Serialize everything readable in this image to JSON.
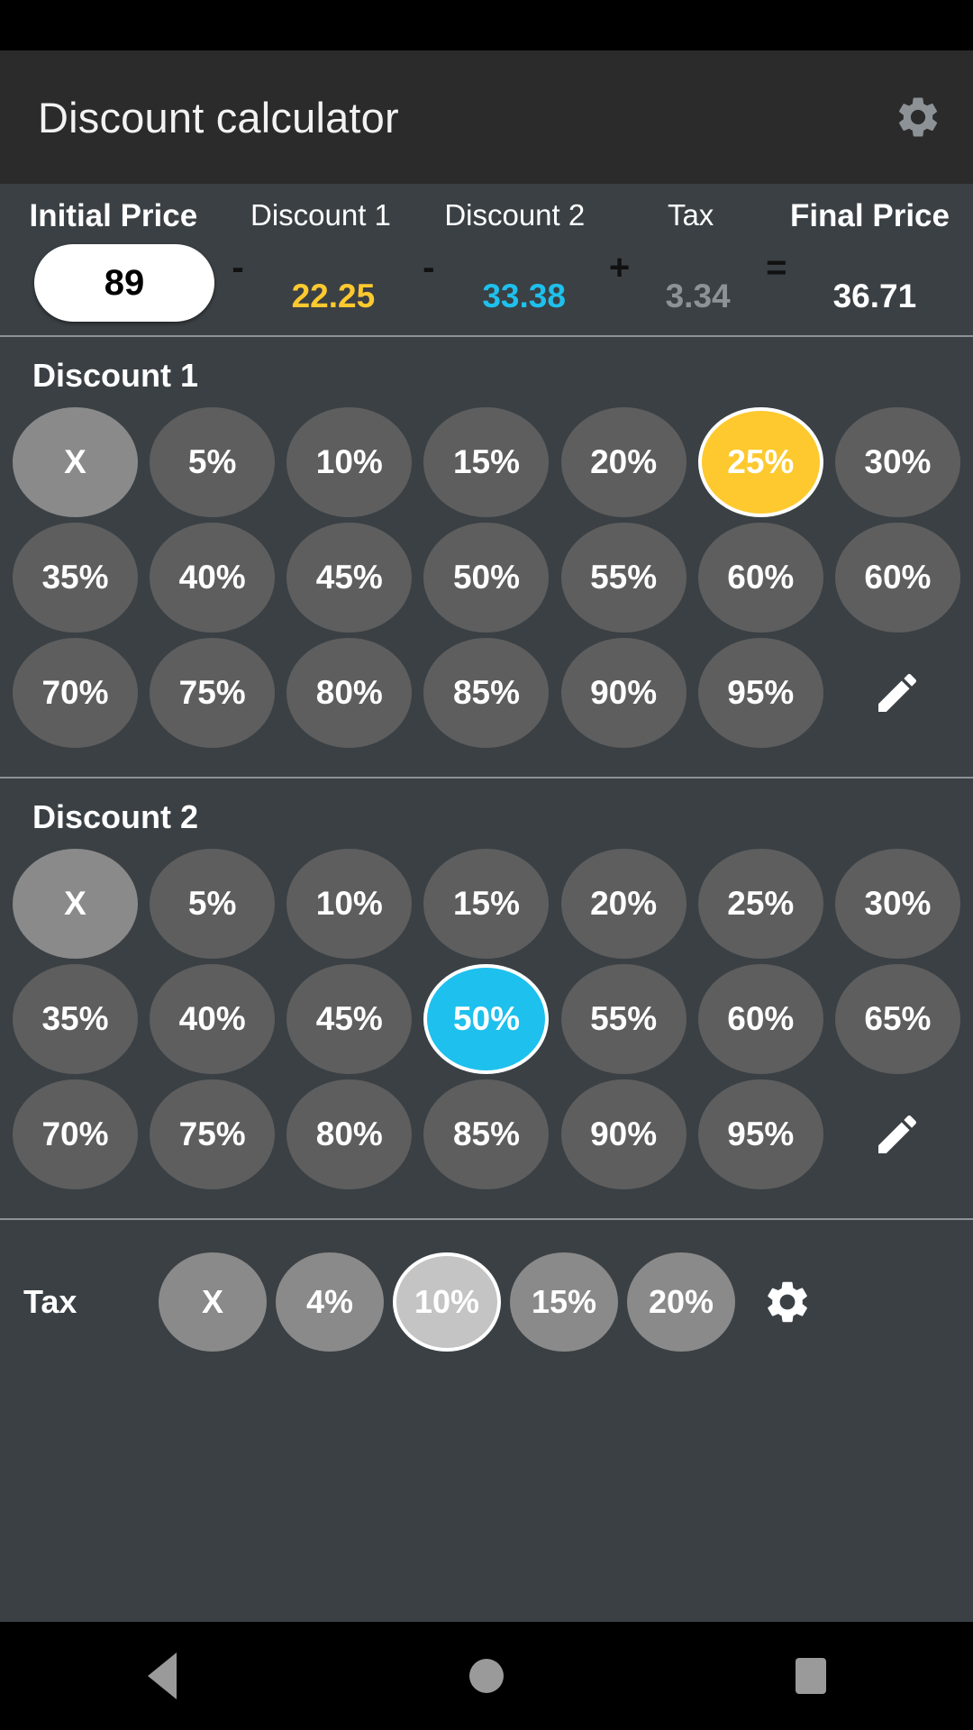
{
  "app": {
    "title": "Discount calculator",
    "settings_icon": "gear-icon"
  },
  "summary": {
    "initial_price": {
      "label": "Initial Price",
      "value": "89"
    },
    "op_minus_1": "-",
    "discount_1": {
      "label": "Discount 1",
      "value": "22.25",
      "color": "#fdc92f"
    },
    "op_minus_2": "-",
    "discount_2": {
      "label": "Discount 2",
      "value": "33.38",
      "color": "#1ec0ed"
    },
    "op_plus": "+",
    "tax": {
      "label": "Tax",
      "value": "3.34",
      "color": "#8d9296"
    },
    "op_equals": "=",
    "final_price": {
      "label": "Final Price",
      "value": "36.71",
      "color": "#ffffff"
    }
  },
  "discount1": {
    "title": "Discount 1",
    "selected": "25%",
    "accent": "#fdc92f",
    "rows": [
      [
        "X",
        "5%",
        "10%",
        "15%",
        "20%",
        "25%",
        "30%"
      ],
      [
        "35%",
        "40%",
        "45%",
        "50%",
        "55%",
        "60%",
        "60%"
      ],
      [
        "70%",
        "75%",
        "80%",
        "85%",
        "90%",
        "95%",
        "edit-pencil-icon"
      ]
    ]
  },
  "discount2": {
    "title": "Discount 2",
    "selected": "50%",
    "accent": "#1ec0ed",
    "rows": [
      [
        "X",
        "5%",
        "10%",
        "15%",
        "20%",
        "25%",
        "30%"
      ],
      [
        "35%",
        "40%",
        "45%",
        "50%",
        "55%",
        "60%",
        "65%"
      ],
      [
        "70%",
        "75%",
        "80%",
        "85%",
        "90%",
        "95%",
        "edit-pencil-icon"
      ]
    ]
  },
  "tax_section": {
    "label": "Tax",
    "selected": "10%",
    "options": [
      "X",
      "4%",
      "10%",
      "15%",
      "20%"
    ],
    "settings_icon": "gear-icon"
  },
  "nav_bar": {
    "back": "back-triangle-icon",
    "home": "home-circle-icon",
    "recents": "recents-square-icon"
  }
}
